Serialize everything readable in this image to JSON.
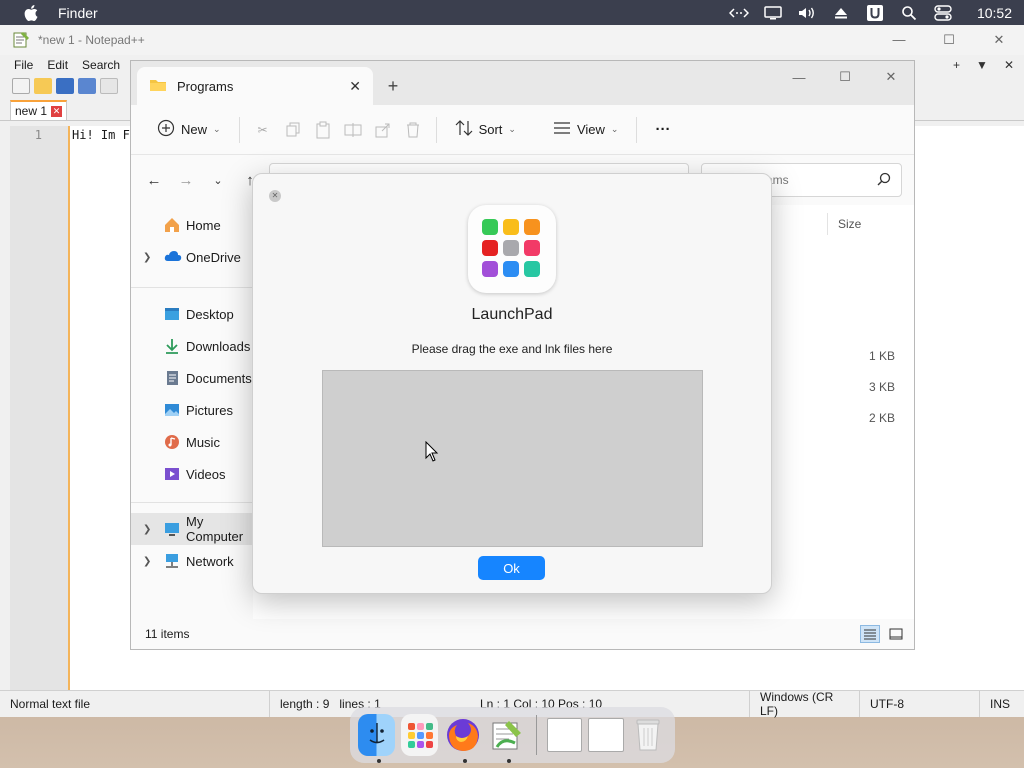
{
  "menubar": {
    "app_name": "Finder",
    "clock": "10:52",
    "icons": [
      "code-arrows-icon",
      "display-icon",
      "volume-icon",
      "eject-icon",
      "u-menu-icon",
      "search-icon",
      "control-center-icon"
    ]
  },
  "notepad": {
    "title": "*new 1 - Notepad++",
    "menu": [
      "File",
      "Edit",
      "Search"
    ],
    "right_controls": [
      "+",
      "▼",
      "✕"
    ],
    "tab_label": "new 1",
    "line_number": "1",
    "code_text": "Hi! Im F",
    "status": {
      "type": "Normal text file",
      "length": "length : 9",
      "lines": "lines : 1",
      "position": "Ln : 1    Col : 10    Pos : 10",
      "eol": "Windows (CR LF)",
      "encoding": "UTF-8",
      "mode": "INS"
    }
  },
  "explorer": {
    "tab_title": "Programs",
    "new_tab": "+",
    "commands": {
      "new": "New",
      "sort": "Sort",
      "view": "View",
      "more": "···"
    },
    "search_placeholder": "Search Programs",
    "search_visible": "rams",
    "sidebar": {
      "home": "Home",
      "onedrive": "OneDrive",
      "desktop": "Desktop",
      "downloads": "Downloads",
      "documents": "Documents",
      "pictures": "Pictures",
      "music": "Music",
      "videos": "Videos",
      "my_computer": "My Computer",
      "network": "Network"
    },
    "column_size": "Size",
    "sizes": [
      "1 KB",
      "3 KB",
      "2 KB"
    ],
    "item_count": "11 items"
  },
  "dialog": {
    "title": "LaunchPad",
    "subtitle": "Please drag the exe and lnk files here",
    "ok_label": "Ok",
    "icon_colors": [
      "#36c957",
      "#f9bd1a",
      "#f7921e",
      "#e52222",
      "#a9a9ad",
      "#f23a67",
      "#a24fd8",
      "#2c8df3",
      "#27c7a2"
    ]
  },
  "dock": {
    "apps": [
      "finder-icon",
      "launchpad-icon",
      "firefox-icon",
      "notepadpp-icon"
    ],
    "trash": "trash-icon"
  }
}
